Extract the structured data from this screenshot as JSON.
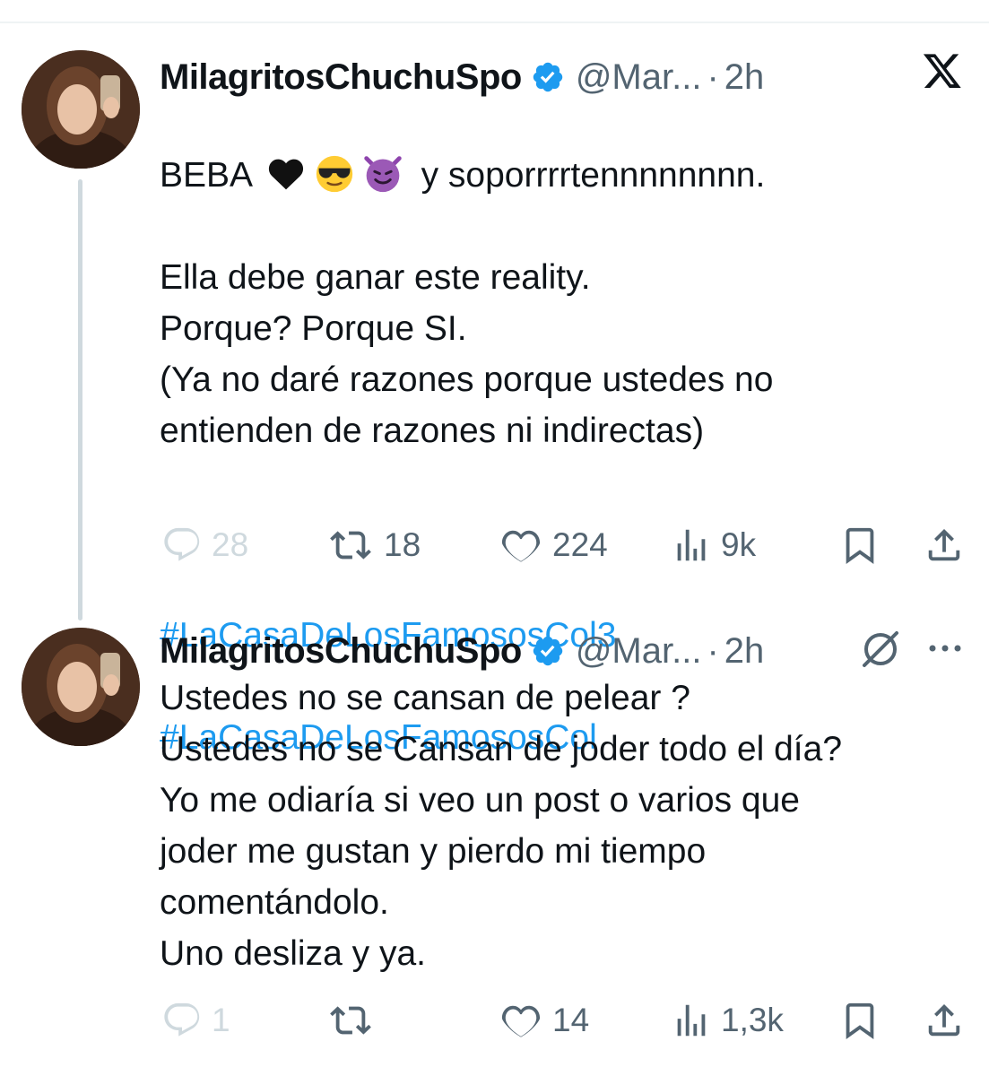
{
  "tweets": [
    {
      "display_name": "MilagritosChuchuSpo",
      "handle": "@Mar...",
      "separator": "·",
      "time": "2h",
      "text_first": "y soporrrrtennnnnnnn.",
      "text_prefix": "BEBA",
      "text_rest": "Ella debe ganar este reality.\nPorque? Porque SI.\n(Ya no daré razones porque ustedes no\nentienden de razones ni indirectas)",
      "hashtags": [
        "#LaCasaDeLosFamososCol3",
        "#LaCasaDeLosFamososCol"
      ],
      "emojis": [
        "black-heart-emoji",
        "sunglasses-emoji",
        "smiling-devil-emoji"
      ],
      "stats": {
        "replies": "28",
        "retweets": "18",
        "likes": "224",
        "views": "9k"
      }
    },
    {
      "display_name": "MilagritosChuchuSpo",
      "handle": "@Mar...",
      "separator": "·",
      "time": "2h",
      "text": "Ustedes no se cansan de pelear ?\nUstedes no se Cansan de joder todo el día?\nYo me odiaría si veo un post o varios que\njoder me gustan y pierdo mi tiempo\ncomentándolo.\nUno desliza y ya.",
      "stats": {
        "replies": "1",
        "retweets": "",
        "likes": "14",
        "views": "1,3k"
      }
    }
  ],
  "icons": {
    "verified": "verified-badge-icon",
    "app_logo": "x-logo-icon",
    "grok": "grok-icon",
    "more": "more-icon"
  },
  "colors": {
    "text": "#0f1419",
    "muted": "#536471",
    "link": "#1d9bf0",
    "divider": "#eff3f4",
    "thread_line": "#cfd9de",
    "verified": "#1d9bf0"
  }
}
